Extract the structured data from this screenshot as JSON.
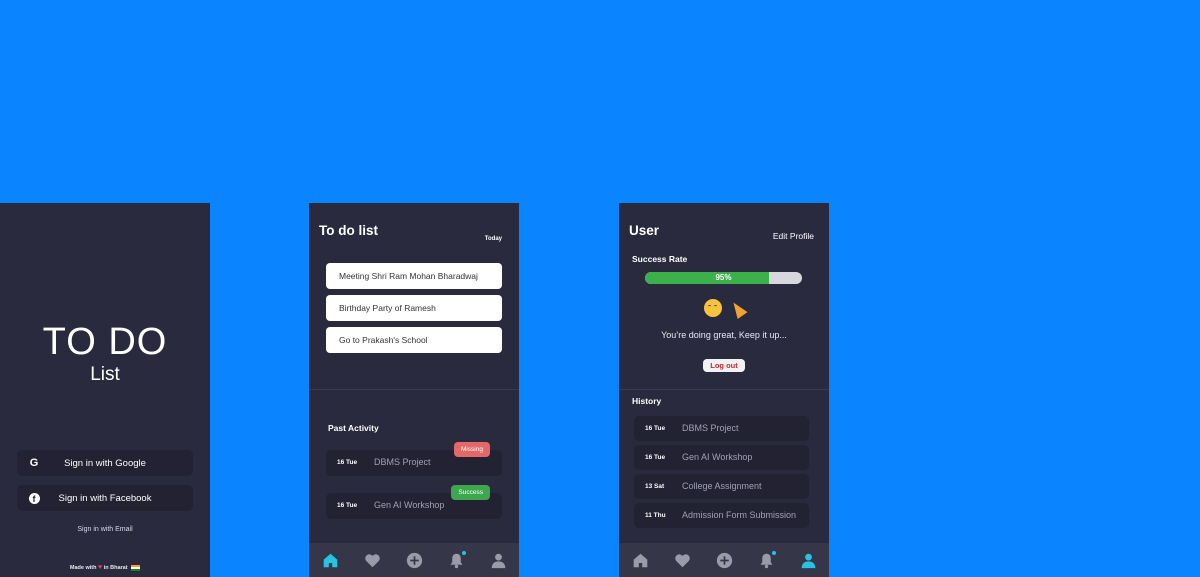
{
  "login": {
    "title": "TO DO",
    "subtitle": "List",
    "google_label": "Sign in with Google",
    "facebook_label": "Sign in with Facebook",
    "email_label": "Sign in with Email",
    "made_with_prefix": "Made with",
    "made_with_suffix": "in Bharat"
  },
  "todo": {
    "title": "To do list",
    "date_label": "Today",
    "tasks": [
      {
        "text": "Meeting Shri Ram Mohan Bharadwaj"
      },
      {
        "text": "Birthday Party of Ramesh"
      },
      {
        "text": "Go to Prakash's School"
      }
    ],
    "past_title": "Past Activity",
    "past": [
      {
        "date": "16 Tue",
        "name": "DBMS Project",
        "status": "Missing"
      },
      {
        "date": "16 Tue",
        "name": "Gen AI Workshop",
        "status": "Success"
      }
    ]
  },
  "profile": {
    "title": "User",
    "edit_label": "Edit Profile",
    "success_label": "Success Rate",
    "success_value": 0.95,
    "success_text": "95%",
    "motivation": "You’re doing great, Keep it up...",
    "logout_label": "Log out",
    "history_title": "History",
    "history": [
      {
        "date": "16 Tue",
        "name": "DBMS Project"
      },
      {
        "date": "16 Tue",
        "name": "Gen AI Workshop"
      },
      {
        "date": "13 Sat",
        "name": "College Assignment"
      },
      {
        "date": "11 Thu",
        "name": "Admission Form Submission"
      }
    ]
  },
  "nav": {
    "items": [
      "home-icon",
      "heart-icon",
      "add-icon",
      "bell-icon",
      "user-icon"
    ],
    "active_todo": "home",
    "active_profile": "user"
  },
  "colors": {
    "background": "#0a84ff",
    "panel": "#2a2a3e",
    "card": "#222233",
    "accent": "#27c3e0",
    "success": "#3cb04b",
    "missing": "#e46868"
  }
}
